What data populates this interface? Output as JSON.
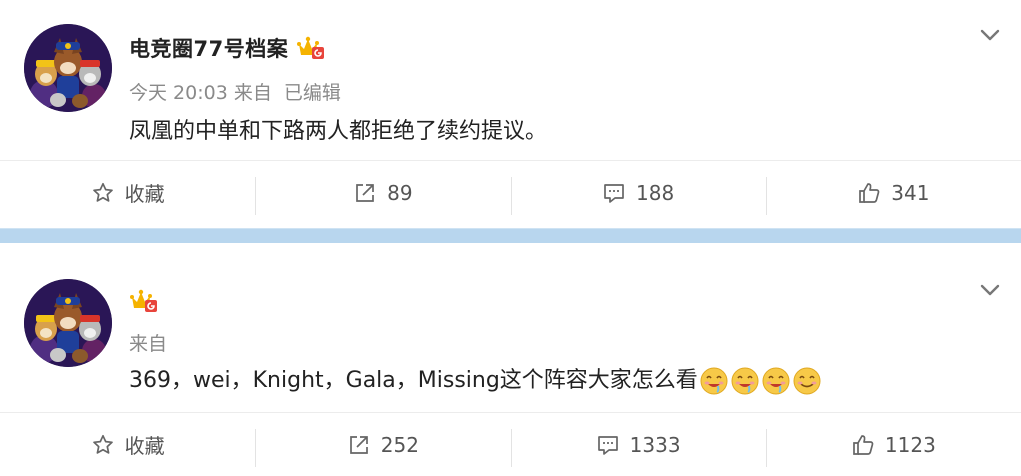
{
  "posts": [
    {
      "username": "电竞圈77号档案",
      "meta": {
        "time": "今天 20:03 来自",
        "edited": "已编辑"
      },
      "content": "凤凰的中单和下路两人都拒绝了续约提议。",
      "emojis": [],
      "actions": {
        "favorite_label": "收藏",
        "repost_count": "89",
        "comment_count": "188",
        "like_count": "341"
      }
    },
    {
      "username": "",
      "meta": {
        "time": "来自",
        "edited": ""
      },
      "content": "369，wei，Knight，Gala，Missing这个阵容大家怎么看",
      "emojis": [
        "drooling-face-emoji",
        "drooling-face-emoji",
        "drooling-face-emoji",
        "smiling-face-emoji"
      ],
      "actions": {
        "favorite_label": "收藏",
        "repost_count": "252",
        "comment_count": "1333",
        "like_count": "1123"
      }
    }
  ],
  "icons": {
    "avatar": "cartoon-dogs-avatar",
    "badge": "vip-crown-badge",
    "more": "chevron-down-icon",
    "favorite": "star-icon",
    "repost": "share-arrow-icon",
    "comment": "comment-bubble-icon",
    "like": "thumbs-up-icon"
  },
  "colors": {
    "separator": "#b8d6ee",
    "text_primary": "#222222",
    "text_secondary": "#8a8a8a",
    "badge_gold": "#f5b300",
    "badge_red": "#e8453c"
  }
}
